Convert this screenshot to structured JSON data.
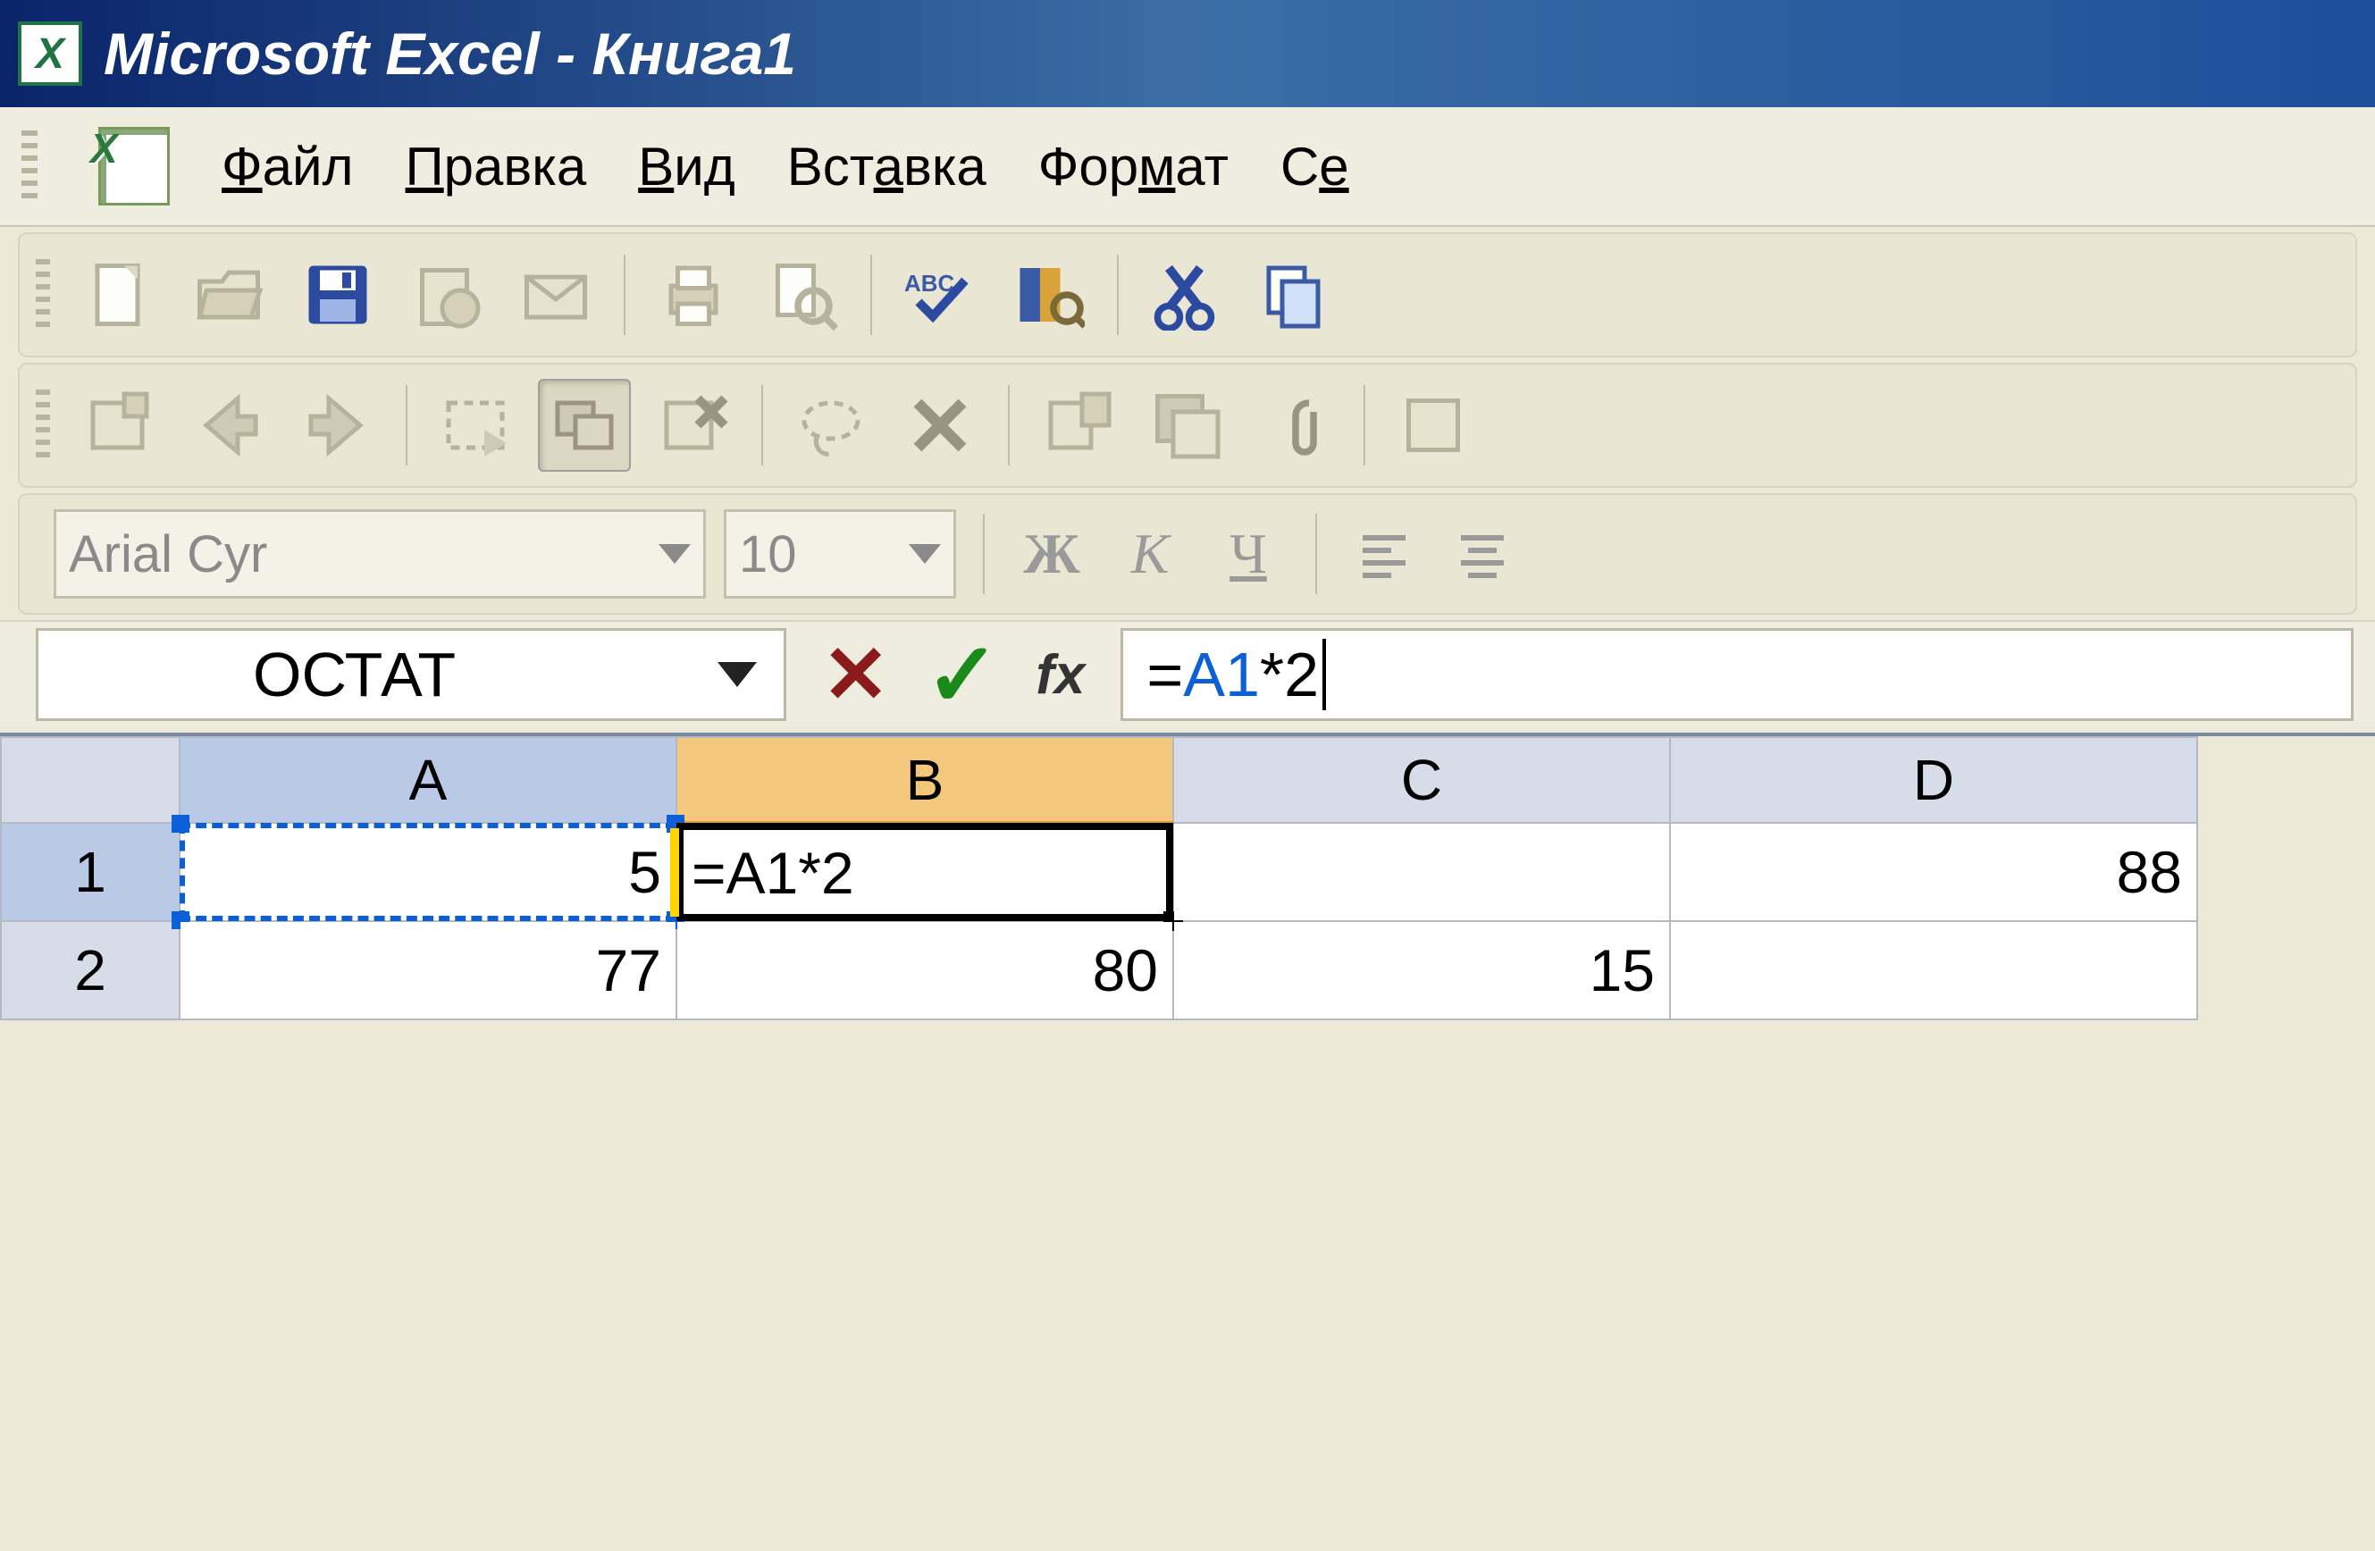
{
  "titlebar": {
    "text": "Microsoft Excel - Книга1"
  },
  "menu": {
    "file": {
      "pre": "",
      "u": "Ф",
      "post": "айл"
    },
    "edit": {
      "pre": "",
      "u": "П",
      "post": "равка"
    },
    "view": {
      "pre": "",
      "u": "В",
      "post": "ид"
    },
    "insert": {
      "pre": "Вст",
      "u": "а",
      "post": "вка"
    },
    "format": {
      "pre": "Фор",
      "u": "м",
      "post": "ат"
    },
    "tools": {
      "pre": "С",
      "u": "е",
      "post": ""
    }
  },
  "fmt": {
    "font_name": "Arial Cyr",
    "font_size": "10",
    "bold": "Ж",
    "italic": "К",
    "underline": "Ч"
  },
  "formula_bar": {
    "name_box": "ОСТАТ",
    "fx_label": "fx",
    "formula_eq": "=",
    "formula_ref": "A1",
    "formula_tail": "*2"
  },
  "columns": [
    "A",
    "B",
    "C",
    "D"
  ],
  "rows": [
    "1",
    "2"
  ],
  "cells": {
    "A1": "5",
    "B1": "=A1*2",
    "C1": "",
    "D1": "88",
    "A2": "77",
    "B2": "80",
    "C2": "15",
    "D2": ""
  }
}
